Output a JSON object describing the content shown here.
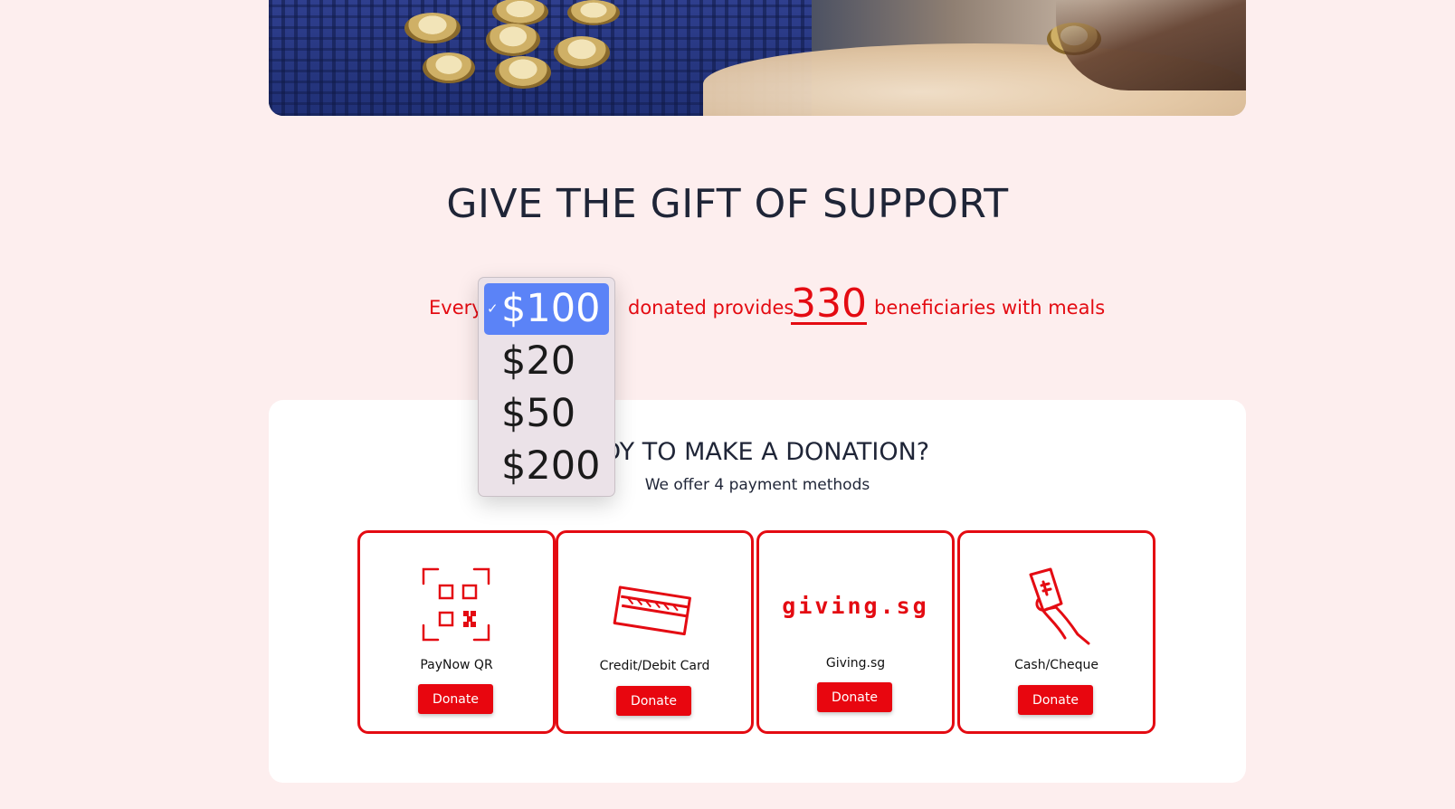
{
  "hero": {
    "image_desc_icon": "food-bank-photo"
  },
  "heading": "GIVE THE GIFT OF SUPPORT",
  "impact": {
    "prefix": "Every",
    "middle": "donated provides",
    "beneficiaries": "330",
    "suffix": "beneficiaries with meals"
  },
  "amount_dropdown": {
    "selected": "$100",
    "options": [
      "$100",
      "$20",
      "$50",
      "$200"
    ],
    "check_icon": "checkmark-icon"
  },
  "donation_panel": {
    "title": "ADY TO MAKE A DONATION?",
    "subtitle": "We offer 4 payment methods",
    "methods": [
      {
        "name": "PayNow QR",
        "icon": "qr-code-icon",
        "button": "Donate"
      },
      {
        "name": "Credit/Debit Card",
        "icon": "credit-card-icon",
        "button": "Donate"
      },
      {
        "name": "Giving.sg",
        "logo_text": "giving.sg",
        "icon": "giving-sg-logo",
        "button": "Donate"
      },
      {
        "name": "Cash/Cheque",
        "icon": "cash-hand-icon",
        "button": "Donate"
      }
    ]
  },
  "colors": {
    "accent": "#e40b12",
    "background": "#fdeeee",
    "selection": "#5b83f7"
  }
}
